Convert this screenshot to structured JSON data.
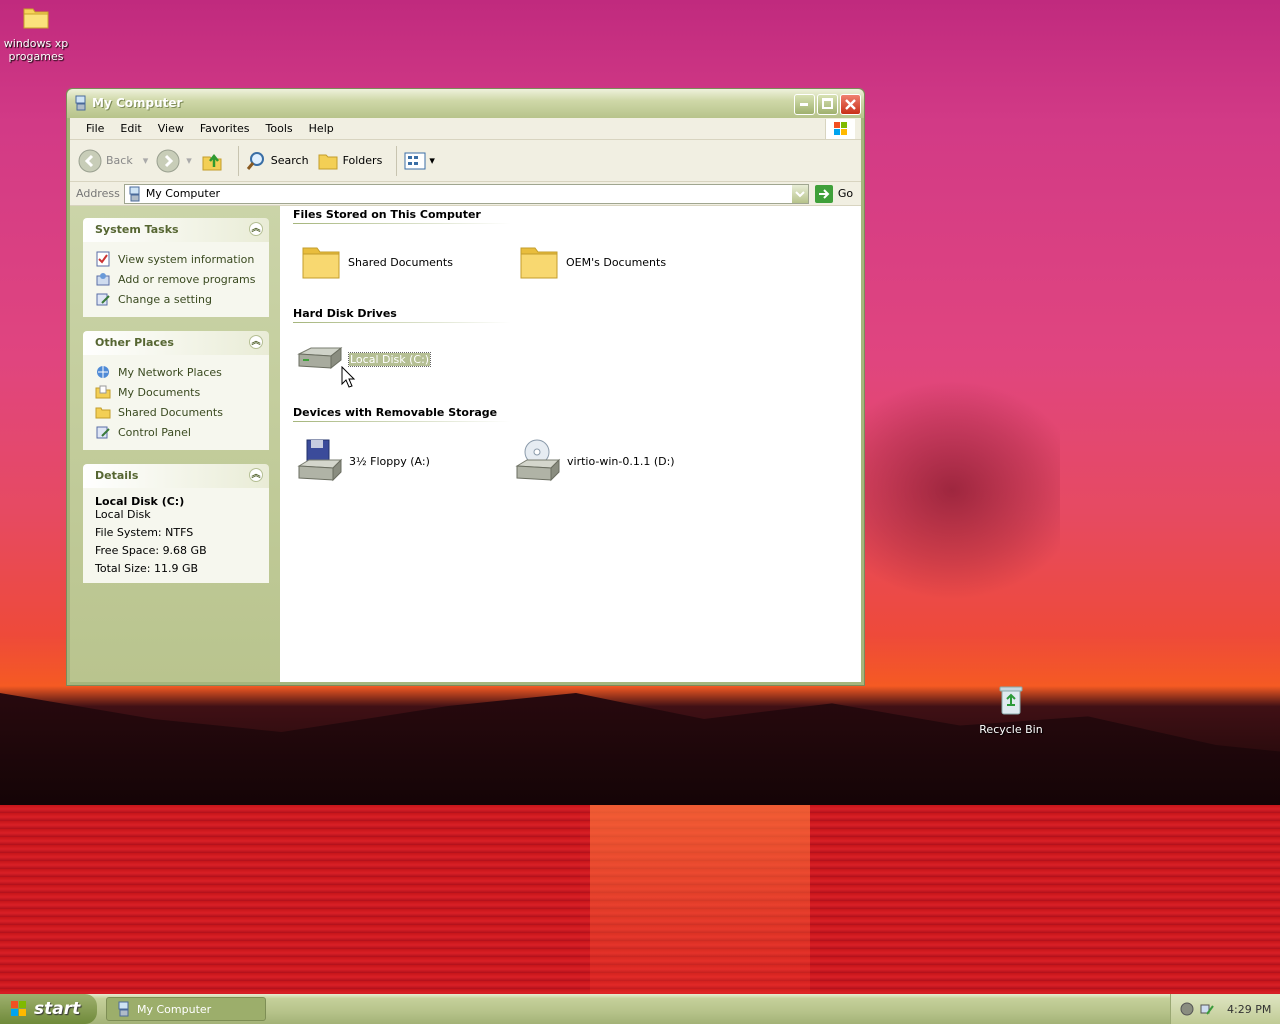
{
  "desktop": {
    "icons": [
      {
        "label": "windows xp progames"
      },
      {
        "label": "Recycle Bin"
      }
    ]
  },
  "window": {
    "title": "My Computer",
    "menu": [
      "File",
      "Edit",
      "View",
      "Favorites",
      "Tools",
      "Help"
    ],
    "toolbar": {
      "back": "Back",
      "search": "Search",
      "folders": "Folders"
    },
    "address": {
      "label": "Address",
      "value": "My Computer",
      "go": "Go"
    },
    "system_tasks": {
      "title": "System Tasks",
      "items": [
        "View system information",
        "Add or remove programs",
        "Change a setting"
      ]
    },
    "other_places": {
      "title": "Other Places",
      "items": [
        "My Network Places",
        "My Documents",
        "Shared Documents",
        "Control Panel"
      ]
    },
    "details": {
      "title": "Details",
      "name": "Local Disk (C:)",
      "type": "Local Disk",
      "file_system": "File System: NTFS",
      "free_space": "Free Space: 9.68 GB",
      "total_size": "Total Size: 11.9 GB"
    },
    "groups": {
      "files": {
        "title": "Files Stored on This Computer",
        "items": [
          "Shared Documents",
          "OEM's Documents"
        ]
      },
      "hdd": {
        "title": "Hard Disk Drives",
        "items": [
          "Local Disk (C:)"
        ]
      },
      "removable": {
        "title": "Devices with Removable Storage",
        "items": [
          "3½ Floppy (A:)",
          "virtio-win-0.1.1 (D:)"
        ]
      }
    }
  },
  "taskbar": {
    "start": "start",
    "task": "My Computer",
    "clock": "4:29 PM"
  },
  "colors": {
    "accent": "#a5b57c",
    "panel_header_text": "#566632"
  }
}
